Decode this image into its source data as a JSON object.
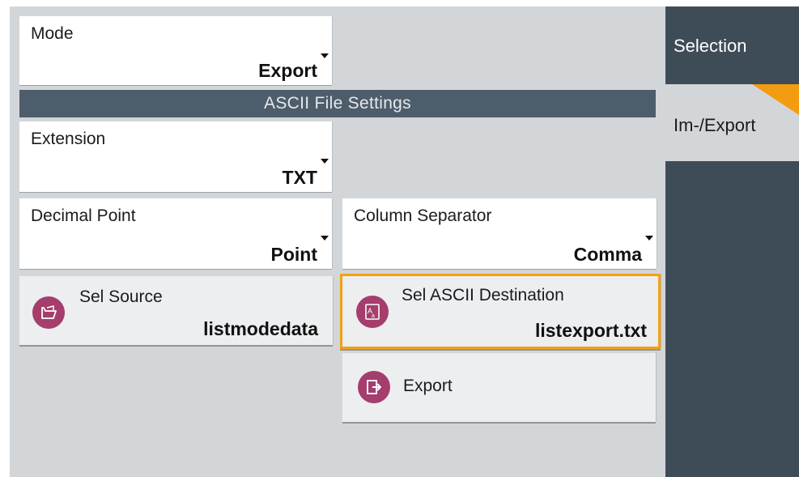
{
  "mode": {
    "label": "Mode",
    "value": "Export"
  },
  "section": {
    "title": "ASCII File Settings"
  },
  "extension": {
    "label": "Extension",
    "value": "TXT"
  },
  "decimal_point": {
    "label": "Decimal Point",
    "value": "Point"
  },
  "column_separator": {
    "label": "Column Separator",
    "value": "Comma"
  },
  "sel_source": {
    "label": "Sel Source",
    "value": "listmodedata"
  },
  "sel_ascii_destination": {
    "label": "Sel ASCII Destination",
    "value": "listexport.txt"
  },
  "export_button": {
    "label": "Export"
  },
  "tabs": [
    {
      "label": "Selection",
      "active": false
    },
    {
      "label": "Im-/Export",
      "active": true
    }
  ],
  "colors": {
    "accent": "#f39c12",
    "icon_bg": "#a53d6d",
    "header_bg": "#4d5d6b",
    "panel_bg": "#d3d6d9",
    "tab_bg": "#3e4c58"
  }
}
